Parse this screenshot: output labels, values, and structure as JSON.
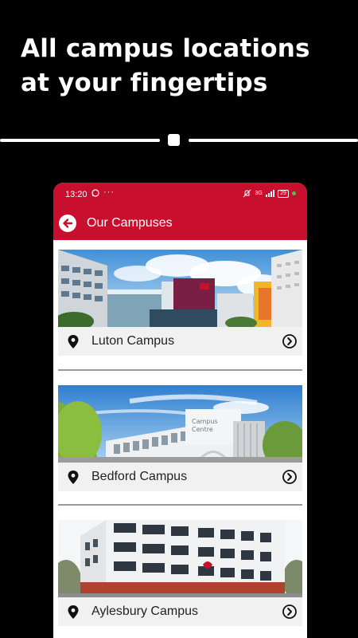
{
  "headline": {
    "line1": "All campus locations",
    "line2": "at your fingertips"
  },
  "status_bar": {
    "time": "13:20",
    "network": "3G",
    "battery": "29",
    "icons": [
      "whatsapp-icon",
      "more-dots-icon",
      "mute-icon",
      "signal-icon",
      "battery-icon"
    ]
  },
  "app_bar": {
    "title": "Our Campuses",
    "back_icon": "arrow-left-icon"
  },
  "campuses": [
    {
      "name": "Luton Campus"
    },
    {
      "name": "Bedford Campus"
    },
    {
      "name": "Aylesbury Campus"
    }
  ],
  "colors": {
    "brand_red": "#c8102e",
    "background": "#000000",
    "card_bar": "#f1f1f1"
  }
}
